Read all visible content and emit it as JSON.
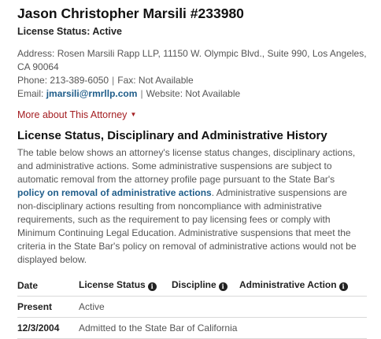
{
  "attorney": {
    "name": "Jason Christopher Marsili #233980",
    "license_status": "License Status: Active"
  },
  "contact": {
    "address": "Address: Rosen Marsili Rapp LLP, 11150 W. Olympic Blvd., Suite 990, Los Angeles, CA 90064",
    "phone": "Phone: 213-389-6050",
    "fax": "Fax: Not Available",
    "email_label": "Email:",
    "email": "jmarsili@rmrllp.com",
    "website": "Website: Not Available",
    "separator": "|"
  },
  "more_link": {
    "label": "More about This Attorney",
    "caret": "▼"
  },
  "history": {
    "title": "License Status, Disciplinary and Administrative History",
    "para_part1": "The table below shows an attorney's license status changes, disciplinary actions, and administrative actions. Some administrative suspensions are subject to automatic removal from the attorney profile page pursuant to the State Bar's ",
    "policy_link": "policy on removal of administrative actions",
    "para_part2": ". Administrative suspensions are non-disciplinary actions resulting from noncompliance with administrative requirements, such as the requirement to pay licensing fees or comply with Minimum Continuing Legal Education. Administrative suspensions that meet the criteria in the State Bar's policy on removal of administrative actions would not be displayed below.",
    "columns": {
      "date": "Date",
      "license_status": "License Status",
      "discipline": "Discipline",
      "administrative_action": "Administrative Action"
    },
    "info_icon_glyph": "i",
    "rows": [
      {
        "date": "Present",
        "license_status": "Active",
        "discipline": "",
        "administrative_action": ""
      },
      {
        "date": "12/3/2004",
        "license_status": "Admitted to the State Bar of California",
        "discipline": "",
        "administrative_action": ""
      }
    ]
  },
  "colors": {
    "link": "#1f5d8a",
    "more_link": "#a41e22",
    "text": "#555555",
    "heading": "#111111"
  }
}
